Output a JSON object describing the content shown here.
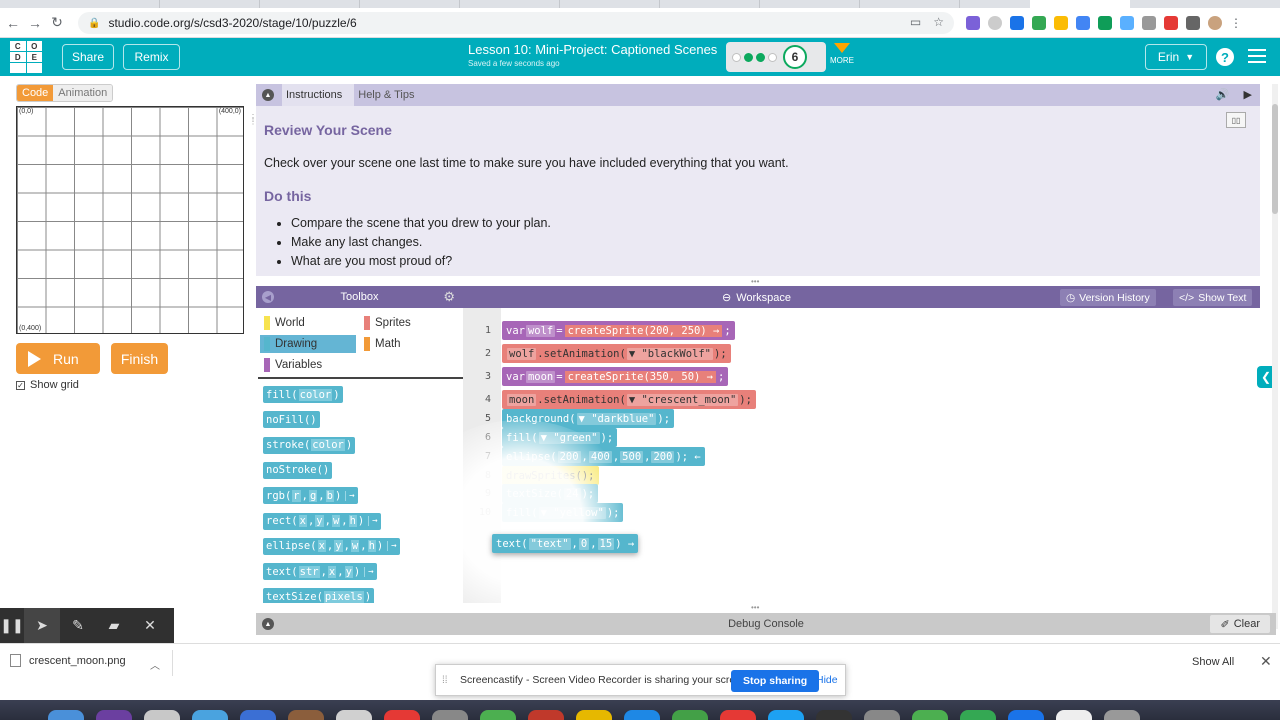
{
  "browser": {
    "url": "studio.code.org/s/csd3-2020/stage/10/puzzle/6"
  },
  "header": {
    "logo_letters": [
      "C",
      "O",
      "D",
      "E"
    ],
    "share_label": "Share",
    "remix_label": "Remix",
    "lesson_title": "Lesson 10: Mini-Project: Captioned Scenes",
    "saved_status": "Saved a few seconds ago",
    "level_number": "6",
    "progress_done": 3,
    "progress_total": 5,
    "more_label": "MORE",
    "user_name": "Erin",
    "help_glyph": "?"
  },
  "visualization": {
    "code_tab": "Code",
    "animation_tab": "Animation",
    "corner_top_left": "(0,0)",
    "corner_top_right": "(400,0)",
    "corner_bottom_left": "(0,400)",
    "run_label": "Run",
    "finish_label": "Finish",
    "show_grid_label": "Show grid",
    "show_grid_checked": true
  },
  "instructions": {
    "tab_instructions": "Instructions",
    "tab_help": "Help & Tips",
    "heading1": "Review Your Scene",
    "paragraph": "Check over your scene one last time to make sure you have included everything that you want.",
    "heading2": "Do this",
    "bullets": [
      "Compare the scene that you drew to your plan.",
      "Make any last changes.",
      "What are you most proud of?"
    ]
  },
  "toolbox": {
    "title": "Toolbox",
    "categories": [
      {
        "label": "World",
        "color": "#f7e34f"
      },
      {
        "label": "Sprites",
        "color": "#e8807a"
      },
      {
        "label": "Drawing",
        "color": "#55b6cd"
      },
      {
        "label": "Math",
        "color": "#f29a38"
      },
      {
        "label": "Variables",
        "color": "#a766b7"
      }
    ],
    "blocks": [
      {
        "name": "fill",
        "args": [
          "color"
        ],
        "arrow": false
      },
      {
        "name": "noFill",
        "args": [],
        "arrow": false
      },
      {
        "name": "stroke",
        "args": [
          "color"
        ],
        "arrow": false
      },
      {
        "name": "noStroke",
        "args": [],
        "arrow": false
      },
      {
        "name": "rgb",
        "args": [
          "r",
          "g",
          "b"
        ],
        "arrow": true
      },
      {
        "name": "rect",
        "args": [
          "x",
          "y",
          "w",
          "h"
        ],
        "arrow": true
      },
      {
        "name": "ellipse",
        "args": [
          "x",
          "y",
          "w",
          "h"
        ],
        "arrow": true
      },
      {
        "name": "text",
        "args": [
          "str",
          "x",
          "y"
        ],
        "arrow": true
      },
      {
        "name": "textSize",
        "args": [
          "pixels"
        ],
        "arrow": false
      }
    ]
  },
  "workspace": {
    "title": "Workspace",
    "version_history": "Version History",
    "show_text": "Show Text",
    "lines": [
      {
        "n": "1",
        "color": "purple",
        "parts": [
          [
            "t",
            "var "
          ],
          [
            "a",
            "wolf"
          ],
          [
            "t",
            " = "
          ],
          [
            "fn",
            "createSprite(200, 250) →"
          ],
          [
            "t",
            ";"
          ]
        ]
      },
      {
        "n": "2",
        "color": "red",
        "parts": [
          [
            "a",
            "wolf"
          ],
          [
            "t",
            ".setAnimation("
          ],
          [
            "a",
            "▼ \"blackWolf\""
          ],
          [
            "t",
            ");"
          ]
        ]
      },
      {
        "n": "3",
        "color": "purple",
        "parts": [
          [
            "t",
            "var "
          ],
          [
            "a",
            "moon"
          ],
          [
            "t",
            " = "
          ],
          [
            "fn",
            "createSprite(350, 50) →"
          ],
          [
            "t",
            ";"
          ]
        ]
      },
      {
        "n": "4",
        "color": "red",
        "parts": [
          [
            "a",
            "moon"
          ],
          [
            "t",
            ".setAnimation("
          ],
          [
            "a",
            "▼ \"crescent_moon\""
          ],
          [
            "t",
            ");"
          ]
        ]
      },
      {
        "n": "5",
        "color": "blue",
        "parts": [
          [
            "t",
            "background("
          ],
          [
            "a",
            "▼ \"darkblue\""
          ],
          [
            "t",
            ");"
          ]
        ]
      },
      {
        "n": "6",
        "color": "blue",
        "parts": [
          [
            "t",
            "fill("
          ],
          [
            "a",
            "▼ \"green\""
          ],
          [
            "t",
            ");"
          ]
        ]
      },
      {
        "n": "7",
        "color": "blue",
        "parts": [
          [
            "t",
            "ellipse("
          ],
          [
            "a",
            "200"
          ],
          [
            "t",
            ", "
          ],
          [
            "a",
            "400"
          ],
          [
            "t",
            ", "
          ],
          [
            "a",
            "500"
          ],
          [
            "t",
            ", "
          ],
          [
            "a",
            "200"
          ],
          [
            "t",
            "); ←"
          ]
        ]
      },
      {
        "n": "8",
        "color": "yellow",
        "parts": [
          [
            "t",
            "drawSprites();"
          ]
        ]
      },
      {
        "n": "9",
        "color": "blue",
        "parts": [
          [
            "t",
            "textSize("
          ],
          [
            "a",
            "24"
          ],
          [
            "t",
            ");"
          ]
        ]
      },
      {
        "n": "10",
        "color": "blue",
        "parts": [
          [
            "t",
            "fill("
          ],
          [
            "a",
            "▼ \"yellow\""
          ],
          [
            "t",
            ");"
          ]
        ]
      }
    ],
    "dragging_block": {
      "parts": [
        [
          "t",
          "text("
        ],
        [
          "a",
          "\"text\""
        ],
        [
          "t",
          ", "
        ],
        [
          "a",
          "0"
        ],
        [
          "t",
          ", "
        ],
        [
          "a",
          "15"
        ],
        [
          "t",
          ") →"
        ]
      ]
    }
  },
  "debug": {
    "title": "Debug Console",
    "clear_label": "Clear"
  },
  "downloads": {
    "file_name": "crescent_moon.png",
    "show_all": "Show All"
  },
  "screencastify": {
    "message": "Screencastify - Screen Video Recorder is sharing your screen.",
    "stop_label": "Stop sharing",
    "hide_label": "Hide"
  }
}
